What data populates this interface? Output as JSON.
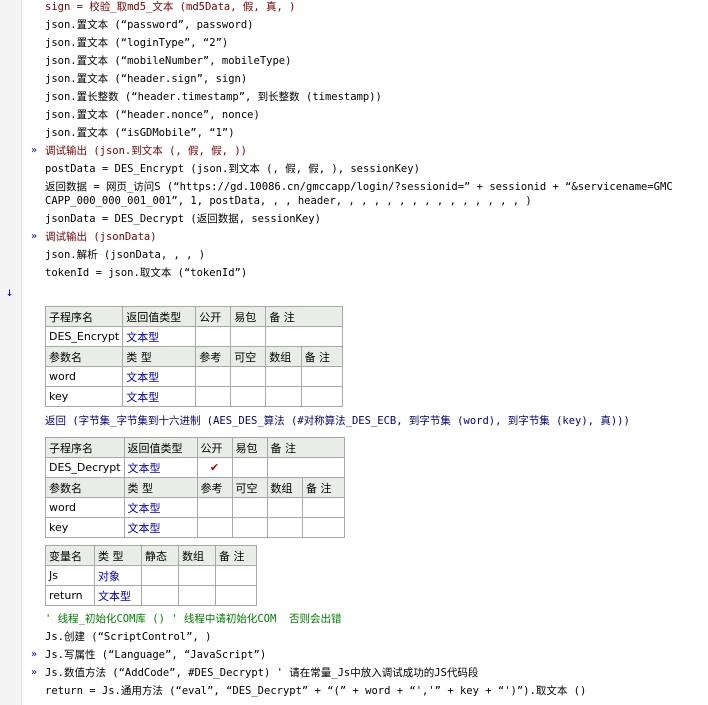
{
  "code_top": [
    "sign = 校验_取md5_文本 (md5Data, 假, 真, )",
    "json.置文本 (“password”, password)",
    "json.置文本 (“loginType”, “2”)",
    "json.置文本 (“mobileNumber”, mobileType)",
    "json.置文本 (“header.sign”, sign)",
    "json.置长整数 (“header.timestamp”, 到长整数 (timestamp))",
    "json.置文本 (“header.nonce”, nonce)",
    "json.置文本 (“isGDMobile”, “1”)",
    "调试输出 (json.到文本 (, 假, 假, ))",
    "postData = DES_Encrypt (json.到文本 (, 假, 假, ), sessionKey)",
    "返回数据 = 网页_访问S (“https://gd.10086.cn/gmccapp/login/?sessionid=” + sessionid + “&servicename=GMC",
    "CAPP_000_000_001_001”, 1, postData, , , header, , , , , , , , , , , , , , , )",
    "jsonData = DES_Decrypt (返回数据, sessionKey)",
    "调试输出 (jsonData)",
    "json.解析 (jsonData, , , )",
    "tokenId = json.取文本 (“tokenId”)"
  ],
  "sub1": {
    "header": [
      "子程序名",
      "返回值类型",
      "公开",
      "易包",
      "备 注"
    ],
    "name": "DES_Encrypt",
    "ret_type": "文本型",
    "public": "",
    "param_header": [
      "参数名",
      "类 型",
      "参考",
      "可空",
      "数组",
      "备 注"
    ],
    "params": [
      {
        "name": "word",
        "type": "文本型"
      },
      {
        "name": "key",
        "type": "文本型"
      }
    ]
  },
  "return_line": "返回 (字节集_字节集到十六进制 (AES_DES_算法 (#对称算法_DES_ECB, 到字节集 (word), 到字节集 (key), 真)))",
  "sub2": {
    "header": [
      "子程序名",
      "返回值类型",
      "公开",
      "易包",
      "备 注"
    ],
    "name": "DES_Decrypt",
    "ret_type": "文本型",
    "public": "✔",
    "param_header": [
      "参数名",
      "类 型",
      "参考",
      "可空",
      "数组",
      "备 注"
    ],
    "params": [
      {
        "name": "word",
        "type": "文本型"
      },
      {
        "name": "key",
        "type": "文本型"
      }
    ]
  },
  "vars": {
    "header": [
      "变量名",
      "类 型",
      "静态",
      "数组",
      "备 注"
    ],
    "rows": [
      {
        "name": "Js",
        "type": "对象"
      },
      {
        "name": "return",
        "type": "文本型"
      }
    ]
  },
  "code_bottom": [
    "' 线程_初始化COM库 () ' 线程中请初始化COM  否则会出错",
    "Js.创建 (“ScriptControl”, )",
    "Js.写属性 (“Language”, “JavaScript”)",
    "Js.数值方法 (“AddCode”, #DES_Decrypt) ' 请在常量_Js中放入调试成功的JS代码段",
    "return = Js.通用方法 (“eval”, “DES_Decrypt” + “(” + word + “','” + key + “')”).取文本 ()"
  ],
  "icons": {
    "marker": "double-chevron-right-icon",
    "arrow": "down-arrow-icon",
    "check": "checkmark-icon"
  }
}
